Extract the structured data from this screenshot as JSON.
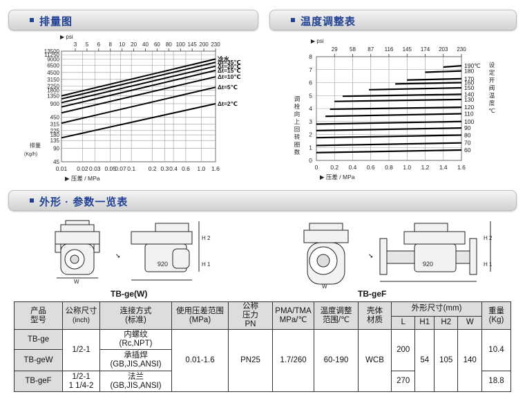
{
  "sections": {
    "chart1_title": "排量图",
    "chart2_title": "温度调整表",
    "section3_title": "外形 · 参数一览表"
  },
  "chart_data": [
    {
      "type": "line",
      "title": "排量图",
      "xlabel": "压差 / MPa",
      "ylabel": "排量 (Kg/h)",
      "top_axis_label": "psi",
      "x_scale": "log",
      "y_scale": "log",
      "x_ticks": [
        "0.01",
        "0.02",
        "0.03",
        "0.05",
        "0.07",
        "0.1",
        "0.2",
        "0.3",
        "0.4",
        "0.6",
        "1.0",
        "1.6"
      ],
      "top_ticks": [
        "3",
        "5",
        "6",
        "8",
        "10",
        "20",
        "40",
        "60",
        "80",
        "100",
        "145",
        "200",
        "230"
      ],
      "y_ticks_left": [
        "13500",
        "11250",
        "9000",
        "6500",
        "4500",
        "3150",
        "2250",
        "1800",
        "1350",
        "900",
        "450",
        "315",
        "225",
        "180",
        "135",
        "90",
        "45"
      ],
      "series": [
        {
          "name": "冷水",
          "x": [
            0.01,
            1.6
          ],
          "y": [
            1350,
            9000
          ]
        },
        {
          "name": "Δt=35℃",
          "x": [
            0.01,
            1.6
          ],
          "y": [
            1150,
            7600
          ]
        },
        {
          "name": "Δt=20℃",
          "x": [
            0.01,
            1.6
          ],
          "y": [
            950,
            6200
          ]
        },
        {
          "name": "Δt=15℃",
          "x": [
            0.01,
            1.6
          ],
          "y": [
            760,
            5000
          ]
        },
        {
          "name": "Δt=10℃",
          "x": [
            0.01,
            1.6
          ],
          "y": [
            560,
            3600
          ]
        },
        {
          "name": "Δt=5℃",
          "x": [
            0.01,
            1.6
          ],
          "y": [
            330,
            2100
          ]
        },
        {
          "name": "Δt=2℃",
          "x": [
            0.01,
            1.6
          ],
          "y": [
            155,
            900
          ]
        }
      ]
    },
    {
      "type": "line",
      "title": "温度调整表",
      "xlabel": "压差 / MPa",
      "ylabel": "调栓向上回转圈数",
      "right_label": "设定开阀温度℃",
      "top_axis_label": "psi",
      "x_ticks": [
        "0",
        "0.2",
        "0.4",
        "0.6",
        "0.8",
        "1.0",
        "1.2",
        "1.4",
        "1.6"
      ],
      "top_ticks": [
        "29",
        "58",
        "87",
        "116",
        "145",
        "174",
        "203",
        "230"
      ],
      "y_ticks": [
        "0",
        "1",
        "2",
        "3",
        "4",
        "5",
        "6",
        "7",
        "8"
      ],
      "xlim": [
        0,
        1.6
      ],
      "ylim": [
        0,
        8
      ],
      "series": [
        {
          "name": "190℃",
          "x": [
            1.4,
            1.6
          ],
          "y": [
            7.2,
            7.3
          ]
        },
        {
          "name": "180",
          "x": [
            1.2,
            1.6
          ],
          "y": [
            6.8,
            6.9
          ]
        },
        {
          "name": "170",
          "x": [
            1.0,
            1.6
          ],
          "y": [
            6.2,
            6.3
          ]
        },
        {
          "name": "160",
          "x": [
            0.87,
            1.6
          ],
          "y": [
            5.9,
            6.0
          ]
        },
        {
          "name": "150",
          "x": [
            0.58,
            1.6
          ],
          "y": [
            5.45,
            5.6
          ]
        },
        {
          "name": "140",
          "x": [
            0.29,
            1.6
          ],
          "y": [
            4.95,
            5.1
          ]
        },
        {
          "name": "130",
          "x": [
            0.2,
            1.6
          ],
          "y": [
            4.55,
            4.7
          ]
        },
        {
          "name": "120",
          "x": [
            0.15,
            1.6
          ],
          "y": [
            3.95,
            4.1
          ]
        },
        {
          "name": "110",
          "x": [
            0.1,
            1.6
          ],
          "y": [
            3.4,
            3.6
          ]
        },
        {
          "name": "100",
          "x": [
            0,
            1.6
          ],
          "y": [
            2.8,
            3.0
          ]
        },
        {
          "name": "90",
          "x": [
            0,
            1.6
          ],
          "y": [
            2.3,
            2.5
          ]
        },
        {
          "name": "80",
          "x": [
            0,
            1.6
          ],
          "y": [
            1.75,
            1.95
          ]
        },
        {
          "name": "70",
          "x": [
            0,
            1.6
          ],
          "y": [
            1.15,
            1.35
          ]
        },
        {
          "name": "60",
          "x": [
            0,
            1.6
          ],
          "y": [
            0.6,
            0.8
          ]
        }
      ]
    }
  ],
  "drawings": {
    "label_a": "TB-ge(W)",
    "label_b": "TB-geF",
    "dim_w": "W",
    "dim_h1": "H 1",
    "dim_h2": "H 2",
    "dim_920": "920"
  },
  "table": {
    "h_product": "产品",
    "h_model": "型号",
    "h_size": "公称尺寸",
    "h_size_unit": "(inch)",
    "h_conn": "连接方式",
    "h_conn_std": "(标准)",
    "h_range": "使用压差范围",
    "h_range_unit": "(MPa)",
    "h_pn1": "公称",
    "h_pn2": "压力",
    "h_pn3": "PN",
    "h_pma": "PMA/TMA",
    "h_pma_unit": "MPa/℃",
    "h_temp": "温度调整",
    "h_temp2": "范围/℃",
    "h_body": "壳体",
    "h_body2": "材质",
    "h_dims": "外形尺寸(mm)",
    "h_L": "L",
    "h_H1": "H1",
    "h_H2": "H2",
    "h_W": "W",
    "h_weight": "重量",
    "h_weight_unit": "(Kg)",
    "m1": "TB-ge",
    "m2": "TB-geW",
    "m3": "TB-geF",
    "size_12": "1/2-1",
    "size_f1": "1/2-1",
    "size_f2": "1 1/4-2",
    "c1a": "内螺纹",
    "c1b": "(Rc,NPT)",
    "c2a": "承插焊",
    "c2b": "(GB,JIS,ANSI)",
    "c3a": "法兰",
    "c3b": "(GB,JIS,ANSI)",
    "range": "0.01-1.6",
    "pn": "PN25",
    "pma": "1.7/260",
    "temp": "60-190",
    "body": "WCB",
    "L1": "200",
    "L2": "270",
    "H1": "54",
    "H2": "105",
    "W": "140",
    "wt1": "10.4",
    "wt2": "18.8"
  }
}
